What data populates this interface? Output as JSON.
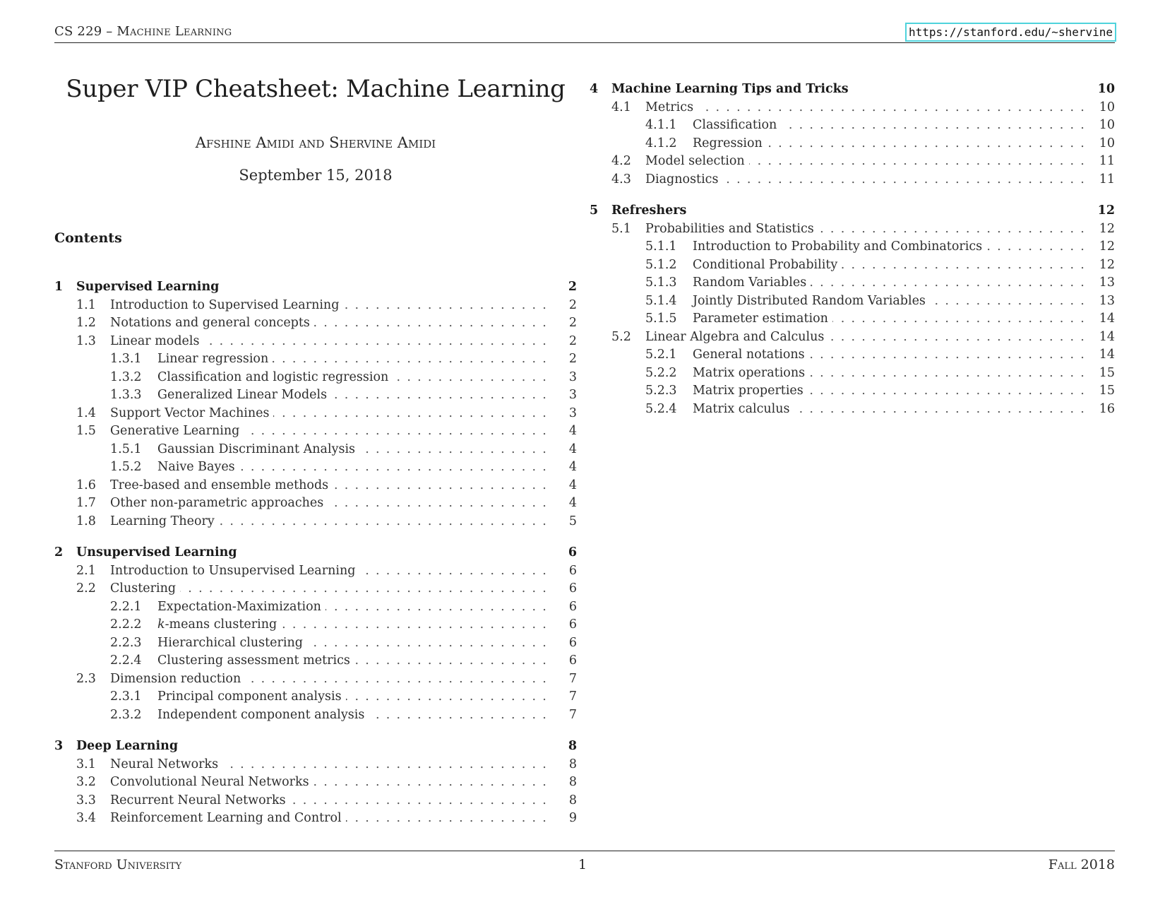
{
  "header": {
    "left": "CS 229 – Machine Learning",
    "link": "https://stanford.edu/~shervine"
  },
  "title": "Super VIP Cheatsheet: Machine Learning",
  "authors": "Afshine Amidi and Shervine Amidi",
  "date": "September 15, 2018",
  "contents_heading": "Contents",
  "toc": {
    "left": [
      {
        "num": "1",
        "label": "Supervised Learning",
        "page": "2",
        "items": [
          {
            "level": 2,
            "num": "1.1",
            "label": "Introduction to Supervised Learning",
            "page": "2"
          },
          {
            "level": 2,
            "num": "1.2",
            "label": "Notations and general concepts",
            "page": "2"
          },
          {
            "level": 2,
            "num": "1.3",
            "label": "Linear models",
            "page": "2"
          },
          {
            "level": 3,
            "num": "1.3.1",
            "label": "Linear regression",
            "page": "2"
          },
          {
            "level": 3,
            "num": "1.3.2",
            "label": "Classification and logistic regression",
            "page": "3"
          },
          {
            "level": 3,
            "num": "1.3.3",
            "label": "Generalized Linear Models",
            "page": "3"
          },
          {
            "level": 2,
            "num": "1.4",
            "label": "Support Vector Machines",
            "page": "3"
          },
          {
            "level": 2,
            "num": "1.5",
            "label": "Generative Learning",
            "page": "4"
          },
          {
            "level": 3,
            "num": "1.5.1",
            "label": "Gaussian Discriminant Analysis",
            "page": "4"
          },
          {
            "level": 3,
            "num": "1.5.2",
            "label": "Naive Bayes",
            "page": "4"
          },
          {
            "level": 2,
            "num": "1.6",
            "label": "Tree-based and ensemble methods",
            "page": "4"
          },
          {
            "level": 2,
            "num": "1.7",
            "label": "Other non-parametric approaches",
            "page": "4"
          },
          {
            "level": 2,
            "num": "1.8",
            "label": "Learning Theory",
            "page": "5"
          }
        ]
      },
      {
        "num": "2",
        "label": "Unsupervised Learning",
        "page": "6",
        "items": [
          {
            "level": 2,
            "num": "2.1",
            "label": "Introduction to Unsupervised Learning",
            "page": "6"
          },
          {
            "level": 2,
            "num": "2.2",
            "label": "Clustering",
            "page": "6"
          },
          {
            "level": 3,
            "num": "2.2.1",
            "label": "Expectation-Maximization",
            "page": "6"
          },
          {
            "level": 3,
            "num": "2.2.2",
            "label": "k-means clustering",
            "page": "6"
          },
          {
            "level": 3,
            "num": "2.2.3",
            "label": "Hierarchical clustering",
            "page": "6"
          },
          {
            "level": 3,
            "num": "2.2.4",
            "label": "Clustering assessment metrics",
            "page": "6"
          },
          {
            "level": 2,
            "num": "2.3",
            "label": "Dimension reduction",
            "page": "7"
          },
          {
            "level": 3,
            "num": "2.3.1",
            "label": "Principal component analysis",
            "page": "7"
          },
          {
            "level": 3,
            "num": "2.3.2",
            "label": "Independent component analysis",
            "page": "7"
          }
        ]
      },
      {
        "num": "3",
        "label": "Deep Learning",
        "page": "8",
        "items": [
          {
            "level": 2,
            "num": "3.1",
            "label": "Neural Networks",
            "page": "8"
          },
          {
            "level": 2,
            "num": "3.2",
            "label": "Convolutional Neural Networks",
            "page": "8"
          },
          {
            "level": 2,
            "num": "3.3",
            "label": "Recurrent Neural Networks",
            "page": "8"
          },
          {
            "level": 2,
            "num": "3.4",
            "label": "Reinforcement Learning and Control",
            "page": "9"
          }
        ]
      }
    ],
    "right": [
      {
        "num": "4",
        "label": "Machine Learning Tips and Tricks",
        "page": "10",
        "items": [
          {
            "level": 2,
            "num": "4.1",
            "label": "Metrics",
            "page": "10"
          },
          {
            "level": 3,
            "num": "4.1.1",
            "label": "Classification",
            "page": "10"
          },
          {
            "level": 3,
            "num": "4.1.2",
            "label": "Regression",
            "page": "10"
          },
          {
            "level": 2,
            "num": "4.2",
            "label": "Model selection",
            "page": "11"
          },
          {
            "level": 2,
            "num": "4.3",
            "label": "Diagnostics",
            "page": "11"
          }
        ]
      },
      {
        "num": "5",
        "label": "Refreshers",
        "page": "12",
        "items": [
          {
            "level": 2,
            "num": "5.1",
            "label": "Probabilities and Statistics",
            "page": "12"
          },
          {
            "level": 3,
            "num": "5.1.1",
            "label": "Introduction to Probability and Combinatorics",
            "page": "12"
          },
          {
            "level": 3,
            "num": "5.1.2",
            "label": "Conditional Probability",
            "page": "12"
          },
          {
            "level": 3,
            "num": "5.1.3",
            "label": "Random Variables",
            "page": "13"
          },
          {
            "level": 3,
            "num": "5.1.4",
            "label": "Jointly Distributed Random Variables",
            "page": "13"
          },
          {
            "level": 3,
            "num": "5.1.5",
            "label": "Parameter estimation",
            "page": "14"
          },
          {
            "level": 2,
            "num": "5.2",
            "label": "Linear Algebra and Calculus",
            "page": "14"
          },
          {
            "level": 3,
            "num": "5.2.1",
            "label": "General notations",
            "page": "14"
          },
          {
            "level": 3,
            "num": "5.2.2",
            "label": "Matrix operations",
            "page": "15"
          },
          {
            "level": 3,
            "num": "5.2.3",
            "label": "Matrix properties",
            "page": "15"
          },
          {
            "level": 3,
            "num": "5.2.4",
            "label": "Matrix calculus",
            "page": "16"
          }
        ]
      }
    ]
  },
  "footer": {
    "left": "Stanford University",
    "page_number": "1",
    "right": "Fall 2018"
  }
}
